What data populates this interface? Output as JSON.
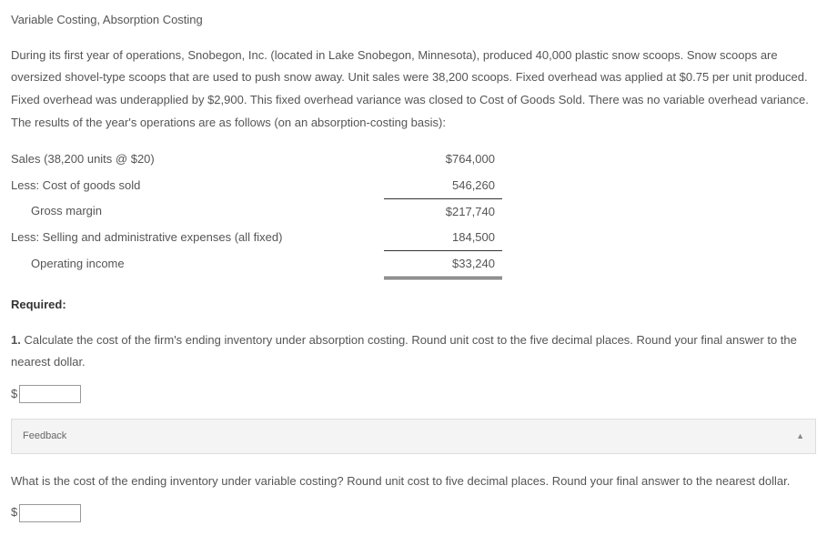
{
  "title": "Variable Costing, Absorption Costing",
  "intro": "During its first year of operations, Snobegon, Inc. (located in Lake Snobegon, Minnesota), produced 40,000 plastic snow scoops. Snow scoops are oversized shovel-type scoops that are used to push snow away. Unit sales were 38,200 scoops. Fixed overhead was applied at $0.75 per unit produced. Fixed overhead was underapplied by $2,900. This fixed overhead variance was closed to Cost of Goods Sold. There was no variable overhead variance. The results of the year's operations are as follows (on an absorption-costing basis):",
  "income": {
    "sales_label": "Sales (38,200 units @ $20)",
    "sales_value": "$764,000",
    "cogs_label": "Less: Cost of goods sold",
    "cogs_value": "546,260",
    "gm_label": "Gross margin",
    "gm_value": "$217,740",
    "sga_label": "Less: Selling and administrative expenses (all fixed)",
    "sga_value": "184,500",
    "opinc_label": "Operating income",
    "opinc_value": "$33,240"
  },
  "required_label": "Required:",
  "q1": {
    "number": "1.",
    "text": " Calculate the cost of the firm's ending inventory under absorption costing. Round unit cost to the five decimal places. Round your final answer to the nearest dollar.",
    "currency": "$"
  },
  "feedback_label": "Feedback",
  "feedback_arrow": "▲",
  "q2": {
    "text": "What is the cost of the ending inventory under variable costing? Round unit cost to five decimal places. Round your final answer to the nearest dollar.",
    "currency": "$"
  }
}
